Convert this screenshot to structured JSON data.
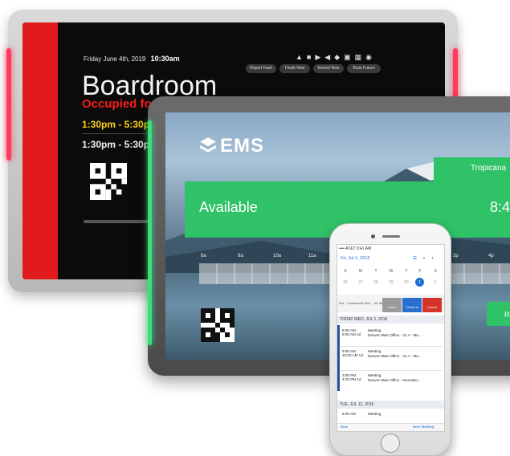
{
  "board_panel": {
    "date": "Friday June 4th, 2019",
    "time": "10:30am",
    "buttons": [
      "Report Fault",
      "Finish Now",
      "Extend Now",
      "Book Future"
    ],
    "room_title": "Boardroom",
    "occupied_text": "Occupied fo",
    "slots": [
      "1:30pm - 5:30p",
      "1:30pm - 5:30p"
    ],
    "accent_color": "#e11b1b"
  },
  "ems_tablet": {
    "logo_text": "EMS",
    "room_name": "Tropicana",
    "status": "Available",
    "status_time": "8:4",
    "timeline_labels": [
      "8a",
      "9a",
      "10a",
      "11a",
      "3p",
      "4p"
    ],
    "reserve_label": "R",
    "accent_color": "#2fc267"
  },
  "phone": {
    "status_bar": "•••• AT&T  9:41 AM",
    "header_date": "Fri, Jul 1, 2016",
    "header_icons": "☰ ⌕ +",
    "weekdays": [
      "S",
      "M",
      "T",
      "W",
      "T",
      "F",
      "S"
    ],
    "dates": [
      "26",
      "27",
      "28",
      "29",
      "30",
      "1",
      "2"
    ],
    "selected_date": "1",
    "action_row_label": "Fitz · Conference Roo… 5h 30m",
    "action_buttons": [
      "Invite",
      "Check In",
      "Cancel"
    ],
    "section_today": "TODAY WED, JUL 1, 2016",
    "section_next": "TUE, JUL 12, 2016",
    "events": [
      {
        "time": "8:00 AM\n9:00 AM 1d",
        "title": "Meeting",
        "location": "Denver Main Office - 31 A - Me..."
      },
      {
        "time": "9:00 AM\n10:00 AM 1d",
        "title": "Meeting",
        "location": "Denver Main Office - 31 A - Me..."
      },
      {
        "time": "3:00 PM\n4:00 PM 1d",
        "title": "Meeting",
        "location": "Denver Main Office - Innovatio..."
      }
    ],
    "next_event": {
      "time": "8:00 AM",
      "title": "Meeting"
    },
    "footer_left": "Now",
    "footer_right": "Next Meeting"
  }
}
